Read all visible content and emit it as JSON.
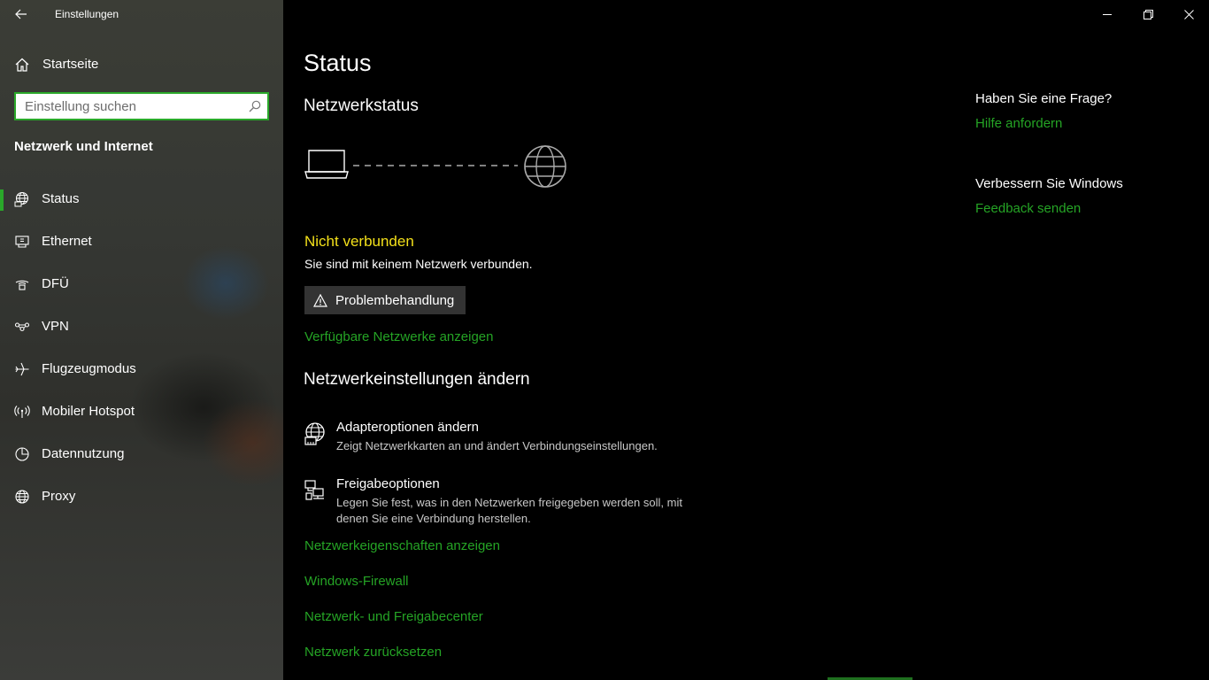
{
  "window": {
    "title": "Einstellungen",
    "back_icon": "arrow-left-icon",
    "controls": [
      "minimize-icon",
      "restore-icon",
      "close-icon"
    ]
  },
  "sidebar": {
    "home_label": "Startseite",
    "search": {
      "placeholder": "Einstellung suchen",
      "value": ""
    },
    "section_title": "Netzwerk und Internet",
    "accent_color": "#2aa82a",
    "items": [
      {
        "label": "Status",
        "icon": "network-status-icon",
        "selected": true
      },
      {
        "label": "Ethernet",
        "icon": "ethernet-icon",
        "selected": false
      },
      {
        "label": "DFÜ",
        "icon": "dialup-icon",
        "selected": false
      },
      {
        "label": "VPN",
        "icon": "vpn-icon",
        "selected": false
      },
      {
        "label": "Flugzeugmodus",
        "icon": "airplane-icon",
        "selected": false
      },
      {
        "label": "Mobiler Hotspot",
        "icon": "hotspot-icon",
        "selected": false
      },
      {
        "label": "Datennutzung",
        "icon": "data-usage-icon",
        "selected": false
      },
      {
        "label": "Proxy",
        "icon": "globe-icon",
        "selected": false
      }
    ]
  },
  "main": {
    "title": "Status",
    "network_status_heading": "Netzwerkstatus",
    "connection": {
      "status": "Nicht verbunden",
      "status_color": "#f3e01a",
      "description": "Sie sind mit keinem Netzwerk verbunden."
    },
    "troubleshoot_label": "Problembehandlung",
    "available_networks_link": "Verfügbare Netzwerke anzeigen",
    "change_settings_heading": "Netzwerkeinstellungen ändern",
    "options": [
      {
        "title": "Adapteroptionen ändern",
        "description": "Zeigt Netzwerkkarten an und ändert Verbindungseinstellungen.",
        "icon": "adapter-icon"
      },
      {
        "title": "Freigabeoptionen",
        "description": "Legen Sie fest, was in den Netzwerken freigegeben werden soll, mit denen Sie eine Verbindung herstellen.",
        "icon": "sharing-icon"
      }
    ],
    "links": [
      "Netzwerkeigenschaften anzeigen",
      "Windows-Firewall",
      "Netzwerk- und Freigabecenter",
      "Netzwerk zurücksetzen"
    ],
    "link_color": "#25a425"
  },
  "help": {
    "question_heading": "Haben Sie eine Frage?",
    "help_link": "Hilfe anfordern",
    "improve_heading": "Verbessern Sie Windows",
    "feedback_link": "Feedback senden"
  }
}
